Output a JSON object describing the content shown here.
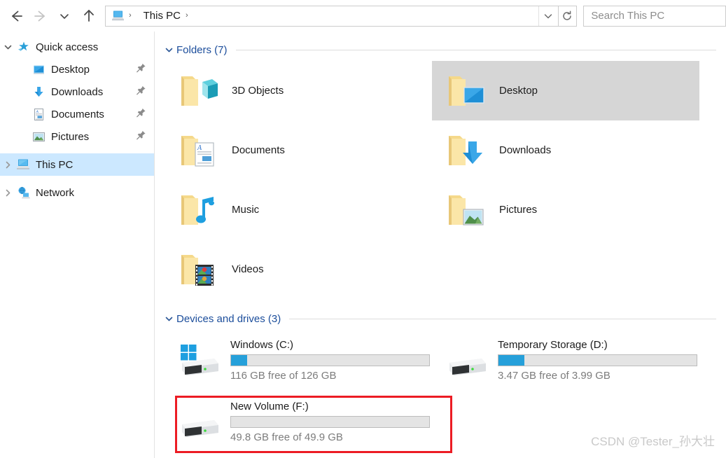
{
  "navbar": {
    "back_label": "Back",
    "forward_label": "Forward",
    "recent_label": "Recent locations",
    "up_label": "Up",
    "breadcrumb": {
      "icon": "this-pc-icon",
      "segments": [
        "This PC"
      ],
      "separator": "›"
    },
    "address_dropdown_label": "⌄",
    "refresh_label": "Refresh",
    "search": {
      "placeholder": "Search This PC",
      "value": ""
    }
  },
  "sidebar": {
    "items": [
      {
        "label": "Quick access",
        "icon": "star-icon",
        "chevron": "expanded",
        "level": 0,
        "selected": false,
        "pinned": false
      },
      {
        "label": "Desktop",
        "icon": "desktop-icon",
        "chevron": "none",
        "level": 1,
        "selected": false,
        "pinned": true
      },
      {
        "label": "Downloads",
        "icon": "downloads-icon",
        "chevron": "none",
        "level": 1,
        "selected": false,
        "pinned": true
      },
      {
        "label": "Documents",
        "icon": "documents-icon",
        "chevron": "none",
        "level": 1,
        "selected": false,
        "pinned": true
      },
      {
        "label": "Pictures",
        "icon": "pictures-icon",
        "chevron": "none",
        "level": 1,
        "selected": false,
        "pinned": true
      },
      {
        "label": "This PC",
        "icon": "this-pc-icon",
        "chevron": "collapsed",
        "level": 0,
        "selected": true,
        "pinned": false
      },
      {
        "label": "Network",
        "icon": "network-icon",
        "chevron": "collapsed",
        "level": 0,
        "selected": false,
        "pinned": false
      }
    ]
  },
  "main": {
    "folders_group": {
      "title": "Folders (7)",
      "chevron": "expanded",
      "items": [
        {
          "label": "3D Objects",
          "icon": "folder-3d-objects-icon",
          "selected": false
        },
        {
          "label": "Desktop",
          "icon": "folder-desktop-icon",
          "selected": true
        },
        {
          "label": "Documents",
          "icon": "folder-documents-icon",
          "selected": false
        },
        {
          "label": "Downloads",
          "icon": "folder-downloads-icon",
          "selected": false
        },
        {
          "label": "Music",
          "icon": "folder-music-icon",
          "selected": false
        },
        {
          "label": "Pictures",
          "icon": "folder-pictures-icon",
          "selected": false
        },
        {
          "label": "Videos",
          "icon": "folder-videos-icon",
          "selected": false
        }
      ]
    },
    "drives_group": {
      "title": "Devices and drives (3)",
      "chevron": "expanded",
      "items": [
        {
          "name": "Windows (C:)",
          "icon": "windows-drive-icon",
          "free_text": "116 GB free of 126 GB",
          "free_gb": 116,
          "total_gb": 126,
          "used_percent": 8
        },
        {
          "name": "Temporary Storage (D:)",
          "icon": "drive-icon",
          "free_text": "3.47 GB free of 3.99 GB",
          "free_gb": 3.47,
          "total_gb": 3.99,
          "used_percent": 13
        },
        {
          "name": "New Volume (F:)",
          "icon": "drive-icon",
          "free_text": "49.8 GB free of 49.9 GB",
          "free_gb": 49.8,
          "total_gb": 49.9,
          "used_percent": 0
        }
      ]
    }
  },
  "annotation": {
    "target": "New Volume (F:)",
    "color": "#ec1c24"
  },
  "watermark": {
    "text": "CSDN @Tester_孙大壮"
  },
  "colors": {
    "accent_blue": "#26a0da",
    "group_title": "#1b4d9b",
    "selection_blue": "#cce8ff",
    "selection_gray": "#d6d6d6",
    "annotation_red": "#ec1c24"
  }
}
